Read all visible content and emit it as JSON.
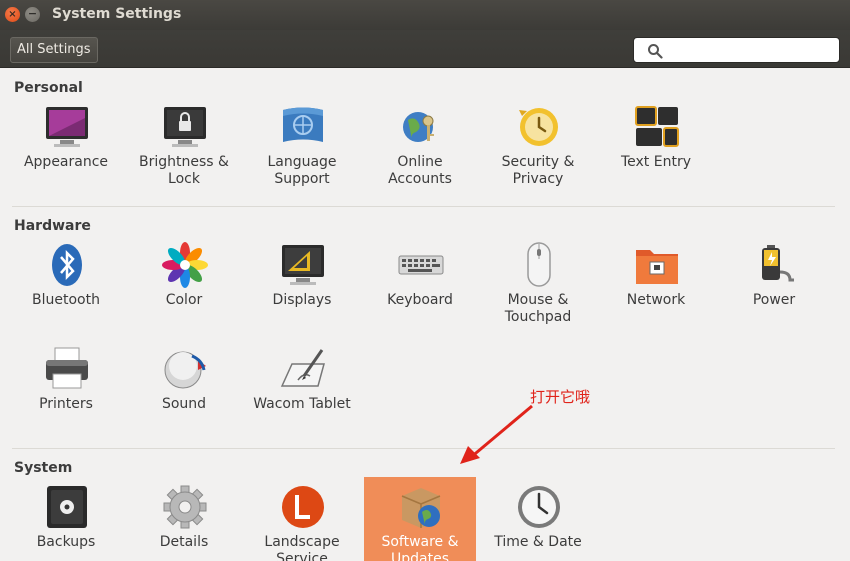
{
  "window": {
    "title": "System Settings",
    "close_glyph": "×",
    "minimize_glyph": "−"
  },
  "toolbar": {
    "all_settings_label": "All Settings",
    "search_placeholder": "",
    "search_value": ""
  },
  "sections": {
    "personal": {
      "title": "Personal",
      "items": [
        {
          "label": "Appearance",
          "icon": "appearance-icon"
        },
        {
          "label": "Brightness &\nLock",
          "icon": "brightness-lock-icon"
        },
        {
          "label": "Language\nSupport",
          "icon": "language-support-icon"
        },
        {
          "label": "Online\nAccounts",
          "icon": "online-accounts-icon"
        },
        {
          "label": "Security &\nPrivacy",
          "icon": "security-privacy-icon"
        },
        {
          "label": "Text Entry",
          "icon": "text-entry-icon"
        }
      ]
    },
    "hardware": {
      "title": "Hardware",
      "items": [
        {
          "label": "Bluetooth",
          "icon": "bluetooth-icon"
        },
        {
          "label": "Color",
          "icon": "color-icon"
        },
        {
          "label": "Displays",
          "icon": "displays-icon"
        },
        {
          "label": "Keyboard",
          "icon": "keyboard-icon"
        },
        {
          "label": "Mouse &\nTouchpad",
          "icon": "mouse-touchpad-icon"
        },
        {
          "label": "Network",
          "icon": "network-icon"
        },
        {
          "label": "Power",
          "icon": "power-icon"
        },
        {
          "label": "Printers",
          "icon": "printers-icon"
        },
        {
          "label": "Sound",
          "icon": "sound-icon"
        },
        {
          "label": "Wacom Tablet",
          "icon": "wacom-tablet-icon"
        }
      ]
    },
    "system": {
      "title": "System",
      "items": [
        {
          "label": "Backups",
          "icon": "backups-icon"
        },
        {
          "label": "Details",
          "icon": "details-icon"
        },
        {
          "label": "Landscape\nService",
          "icon": "landscape-service-icon"
        },
        {
          "label": "Software &\nUpdates",
          "icon": "software-updates-icon",
          "selected": true
        },
        {
          "label": "Time & Date",
          "icon": "time-date-icon"
        }
      ]
    }
  },
  "annotation": {
    "text": "打开它哦",
    "color": "#e0231a"
  },
  "colors": {
    "titlebar": "#3c3b37",
    "selected": "#f08d58",
    "close": "#df4a16"
  }
}
